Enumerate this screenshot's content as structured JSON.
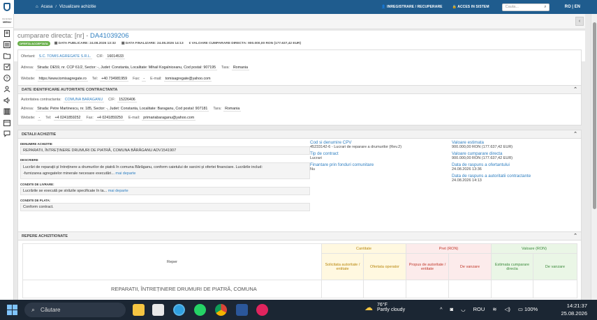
{
  "topbar": {
    "home_label": "Acasa",
    "separator": "/",
    "current": "Vizualizare achizitie",
    "register_link": "INREGISTRARE / RECUPERARE",
    "access_link": "ACCES IN SISTEM",
    "search_placeholder": "Cauta...",
    "lang": "RO | EN"
  },
  "sidebar": {
    "toggle_small": "Ascundere",
    "toggle_label": "MENU"
  },
  "header": {
    "title_prefix": "cumparare directa: [nr] - ",
    "title_code": "DA41039206",
    "status_badge": "OFERTA ACCEPTATA",
    "data_publicare": "DATA PUBLICARE: 24.08.2026 13:32",
    "data_finalizare": "DATA FINALIZARE: 24.08.2026 14:13",
    "valoare": "VALOARE CUMPARARE DIRECTA: 900.000,00 RON (177.637,42 EUR)"
  },
  "ofertant": {
    "label": "Ofertant:",
    "name": "S.C. TOMIS AGREGATE S.R.L.",
    "cif_label": "CIF:",
    "cif": "16014533",
    "adresa_label": "Adresa:",
    "adresa": "Strada: DE59, nr. CCP 61/2, Sector: -, Judet: Constanta, Localitate: Mihail Kogalniceanu, Cod postal: 907195",
    "tara_label": "Tara:",
    "tara": "Romania",
    "website_label": "Website:",
    "website": "https://www.tomisagregate.ro",
    "tel_label": "Tel:",
    "tel": "+40 734981959",
    "fax_label": "Fax:",
    "fax": "-",
    "email_label": "E-mail:",
    "email": "tomisagregate@yahoo.com"
  },
  "autoritate": {
    "section_title": "DATE IDENTIFICARE AUTORITATE CONTRACTANTA",
    "label": "Autoritatea contractanta:",
    "name": "COMUNA BARAGANU",
    "cif_label": "CIF:",
    "cif": "15226406",
    "adresa_label": "Adresa:",
    "adresa": "Strada: Petre Martinescu, nr. 185, Sector: -, Judet: Constanta, Localitate: Baraganu, Cod postal: 907181",
    "tara_label": "Tara:",
    "tara": "Romania",
    "website_label": "Website:",
    "website": "-",
    "tel_label": "Tel:",
    "tel": "+4 0241859252",
    "fax_label": "Fax:",
    "fax": "+4 0241859250",
    "email_label": "E-mail:",
    "email": "primariabaraganu@yahoo.com"
  },
  "detalii": {
    "section_title": "DETALII ACHIZITIE",
    "denumire_label": "DENUMIRE ACHIZITIE",
    "denumire": "REPARATII, ÎNTREȚINERE DRUMURI DE PIATRĂ, COMUNA BĂRĂGANU ADV1541907",
    "descriere_label": "DESCRIERE",
    "descriere_1": "Lucrări de reparații și întreținere a drumurilor de piatră în comuna Bărăganu, conform caietului de sarcini și ofertei financiare. Lucrările includ:",
    "descriere_2": "-furnizarea agregatelor minerale necesare executări...",
    "descriere_more": "mai departe",
    "livrare_label": "CONDITII DE LIVRARE:",
    "livrare": "Lucrările se execută pe străzile specificate în ta...",
    "livrare_more": "mai departe",
    "plata_label": "CONDITII DE PLATA:",
    "plata": "Conform contract.",
    "cpv_label": "Cod si denumire CPV",
    "cpv": "45233142-6 - Lucrari de reparare a drumurilor (Rev.2)",
    "tip_label": "Tip de contract",
    "tip": "Lucrari",
    "finantare_label": "Finantare prin fonduri comunitare",
    "finantare": "Nu",
    "val_est_label": "Valoare estimata",
    "val_est": "900.000,00  RON (177.637,42  EUR)",
    "val_cump_label": "Valoare cumparare directa",
    "val_cump": "900.000,00  RON (177.637,42  EUR)",
    "raspuns_of_label": "Data de raspuns a ofertantului",
    "raspuns_of": "24.08.2026 13:36",
    "raspuns_ac_label": "Data de raspuns a autoritatii contractante",
    "raspuns_ac": "24.08.2026 14:13"
  },
  "repere": {
    "section_title": "REPERE ACHIZITIONATE",
    "col_reper": "Reper",
    "grp_cantitate": "Cantitate",
    "grp_pret": "Pret (RON)",
    "grp_valoare": "Valoare (RON)",
    "c1": "Solicitata autoritate / entitate",
    "c2": "Ofertata operator",
    "p1": "Propus de autoritate / entitate",
    "p2": "De vanzare",
    "v1": "Estimata cumparare directa",
    "v2": "De vanzare",
    "row1": "REPARATII, ÎNTREȚINERE DRUMURI DE PIATRĂ, COMUNA"
  },
  "taskbar": {
    "search": "Căutare",
    "temp": "76°F",
    "weather": "Partly cloudy",
    "lang": "ROU",
    "battery": "100%",
    "time": "14:21:37",
    "date": "25.08.2026"
  }
}
